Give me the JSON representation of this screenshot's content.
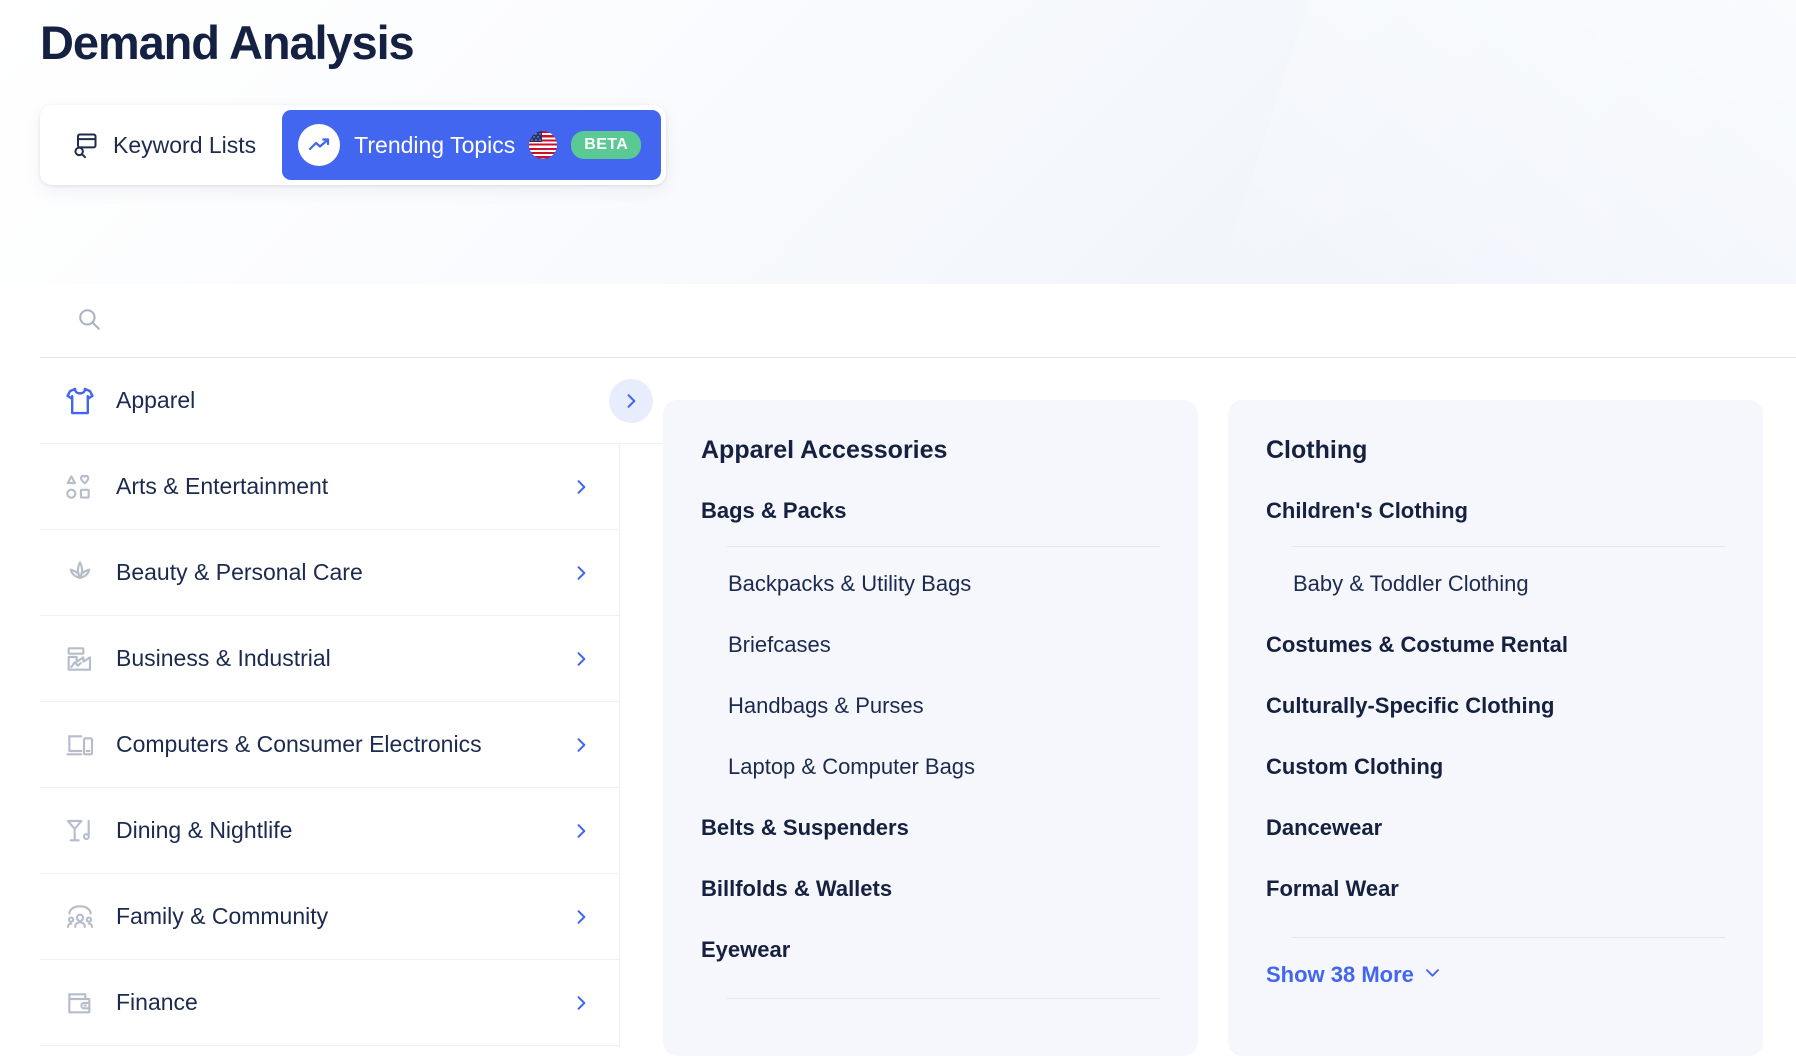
{
  "page": {
    "title": "Demand Analysis",
    "accent_color": "#4366f0",
    "beta_color": "#5ac994",
    "text_color": "#15213f",
    "card_bg": "#f5f7fc"
  },
  "tabs": [
    {
      "id": "keyword-lists",
      "label": "Keyword Lists",
      "icon": "keyword-list-icon",
      "active": false
    },
    {
      "id": "trending-topics",
      "label": "Trending Topics",
      "icon": "trending-up-icon",
      "flag": "us-flag-icon",
      "badge": "BETA",
      "active": true
    }
  ],
  "search": {
    "icon": "search-icon",
    "value": "",
    "placeholder": ""
  },
  "sidebar": {
    "items": [
      {
        "label": "Apparel",
        "icon": "tshirt-icon",
        "active": true
      },
      {
        "label": "Arts & Entertainment",
        "icon": "shapes-icon",
        "active": false
      },
      {
        "label": "Beauty & Personal Care",
        "icon": "lotus-icon",
        "active": false
      },
      {
        "label": "Business & Industrial",
        "icon": "factory-icon",
        "active": false
      },
      {
        "label": "Computers & Consumer Electronics",
        "icon": "devices-icon",
        "active": false
      },
      {
        "label": "Dining & Nightlife",
        "icon": "cocktail-music-icon",
        "active": false
      },
      {
        "label": "Family & Community",
        "icon": "family-icon",
        "active": false
      },
      {
        "label": "Finance",
        "icon": "wallet-icon",
        "active": false
      }
    ]
  },
  "cards": [
    {
      "title": "Apparel Accessories",
      "groups": [
        {
          "heading": "Bags & Packs",
          "divider": true,
          "items": [
            "Backpacks & Utility Bags",
            "Briefcases",
            "Handbags & Purses",
            "Laptop & Computer Bags"
          ]
        },
        {
          "heading": "Belts & Suspenders",
          "divider": false,
          "items": []
        },
        {
          "heading": "Billfolds & Wallets",
          "divider": false,
          "items": []
        },
        {
          "heading": "Eyewear",
          "divider": true,
          "items": []
        }
      ],
      "show_more": null
    },
    {
      "title": "Clothing",
      "groups": [
        {
          "heading": "Children's Clothing",
          "divider": true,
          "items": [
            "Baby & Toddler Clothing"
          ]
        },
        {
          "heading": "Costumes & Costume Rental",
          "divider": false,
          "items": []
        },
        {
          "heading": "Culturally-Specific Clothing",
          "divider": false,
          "items": []
        },
        {
          "heading": "Custom Clothing",
          "divider": false,
          "items": []
        },
        {
          "heading": "Dancewear",
          "divider": false,
          "items": []
        },
        {
          "heading": "Formal Wear",
          "divider": true,
          "items": []
        }
      ],
      "show_more": "Show 38 More"
    }
  ]
}
